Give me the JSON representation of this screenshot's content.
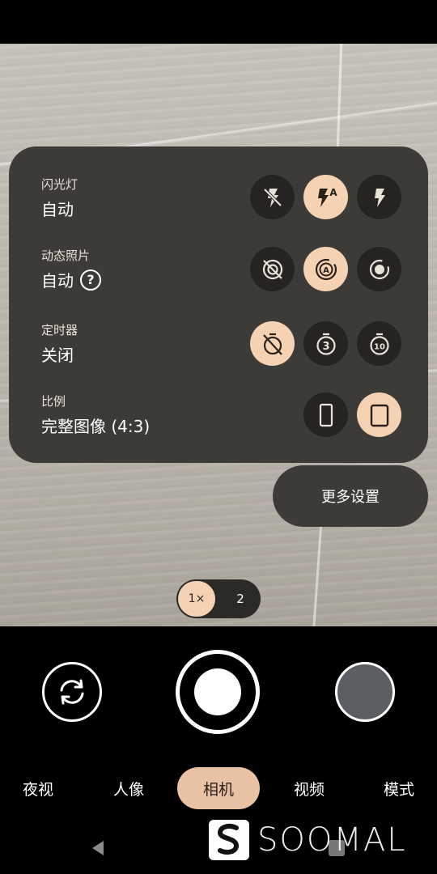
{
  "settings": {
    "flash": {
      "label": "闪光灯",
      "value": "自动",
      "options": [
        {
          "icon": "flash-off-icon",
          "selected": false
        },
        {
          "icon": "flash-auto-icon",
          "selected": true
        },
        {
          "icon": "flash-on-icon",
          "selected": false
        }
      ]
    },
    "motion_photo": {
      "label": "动态照片",
      "value": "自动",
      "help_icon": "help-icon",
      "help_glyph": "?",
      "options": [
        {
          "icon": "motion-off-icon",
          "selected": false
        },
        {
          "icon": "motion-auto-icon",
          "selected": true
        },
        {
          "icon": "motion-on-icon",
          "selected": false
        }
      ]
    },
    "timer": {
      "label": "定时器",
      "value": "关闭",
      "options": [
        {
          "icon": "timer-off-icon",
          "selected": true
        },
        {
          "icon": "timer-3-icon",
          "selected": false,
          "text": "3"
        },
        {
          "icon": "timer-10-icon",
          "selected": false,
          "text": "10"
        }
      ]
    },
    "ratio": {
      "label": "比例",
      "value": "完整图像 (4:3)",
      "options": [
        {
          "icon": "ratio-9-16-icon",
          "selected": false
        },
        {
          "icon": "ratio-3-4-icon",
          "selected": true
        }
      ]
    }
  },
  "more_settings_label": "更多设置",
  "zoom": {
    "options": [
      "1×",
      "2"
    ],
    "selected": "1×"
  },
  "controls": {
    "switch_camera_icon": "switch-camera-icon",
    "shutter_icon": "shutter-button",
    "gallery_icon": "gallery-thumbnail"
  },
  "modes": [
    {
      "label": "夜视",
      "active": false
    },
    {
      "label": "人像",
      "active": false
    },
    {
      "label": "相机",
      "active": true
    },
    {
      "label": "视频",
      "active": false
    },
    {
      "label": "模式",
      "active": false
    }
  ],
  "watermark": {
    "text": "SOOMAL"
  },
  "colors": {
    "panel": "#3d3b38",
    "accent": "#f6d2b5",
    "option_bg": "#262421",
    "mode_active": "#e9c2a6"
  }
}
